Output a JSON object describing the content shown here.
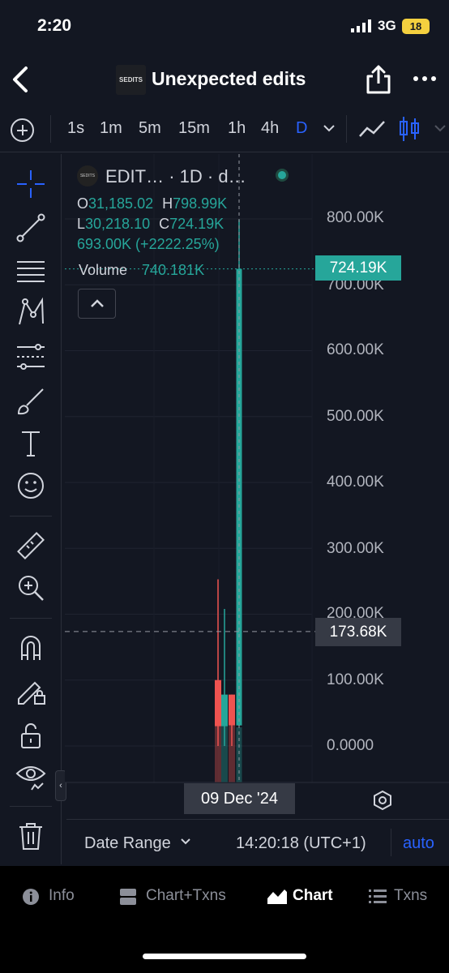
{
  "status_bar": {
    "time": "2:20",
    "network": "3G",
    "battery": "18"
  },
  "header": {
    "title": "Unexpected edits",
    "logo_text": "SEDITS"
  },
  "interval_bar": {
    "intervals": [
      "1s",
      "1m",
      "5m",
      "15m",
      "1h",
      "4h",
      "D"
    ],
    "active": "D"
  },
  "legend": {
    "symbol": "EDIT… · 1D · d…",
    "open_key": "O",
    "open": "31,185.02",
    "high_key": "H",
    "high": "798.99K",
    "low_key": "L",
    "low": "30,218.10",
    "close_key": "C",
    "close": "724.19K",
    "change": "693.00K (+2222.25%)",
    "volume_label": "Volume",
    "volume_value": "740.181K"
  },
  "price_scale": {
    "labels": [
      "800.00K",
      "700.00K",
      "600.00K",
      "500.00K",
      "400.00K",
      "300.00K",
      "200.00K",
      "100.00K",
      "0.0000"
    ],
    "last_price": "724.19K",
    "crosshair_price": "173.68K"
  },
  "time_scale": {
    "crosshair_date": "09 Dec '24"
  },
  "chart_data": {
    "type": "candlestick",
    "y_unit": "price",
    "ylim": [
      -50000,
      860000
    ],
    "candles": [
      {
        "open": 100000,
        "high": 253000,
        "low": 0,
        "close": 30000,
        "direction": "down"
      },
      {
        "open": 30000,
        "high": 208000,
        "low": 0,
        "close": 78000,
        "direction": "up"
      },
      {
        "open": 78000,
        "high": 78000,
        "low": 0,
        "close": 31185,
        "direction": "down"
      },
      {
        "open": 31185,
        "high": 798990,
        "low": 30218,
        "close": 724190,
        "direction": "up"
      }
    ],
    "volume_visible": true,
    "last_price": 724190,
    "crosshair_price": 173680,
    "grid": true
  },
  "footer": {
    "date_range": "Date Range",
    "timezone": "14:20:18 (UTC+1)",
    "auto": "auto"
  },
  "bottom_nav": {
    "items": [
      "Info",
      "Chart+Txns",
      "Chart",
      "Txns"
    ],
    "active": "Chart"
  },
  "colors": {
    "background": "#131722",
    "up": "#26a69a",
    "down": "#ef5350",
    "accent": "#2962ff"
  }
}
